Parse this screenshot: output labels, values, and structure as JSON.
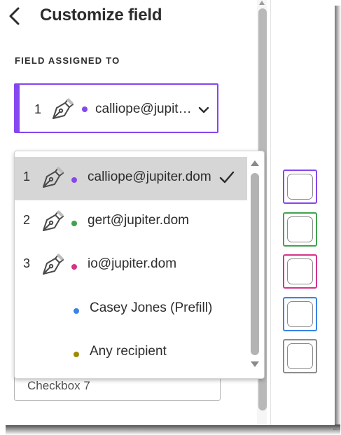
{
  "header": {
    "title": "Customize field"
  },
  "assignment": {
    "section_label": "FIELD ASSIGNED TO",
    "selected": {
      "number": "1",
      "label": "calliope@jupiter.dom",
      "label_truncated": "calliope@jup...",
      "color": "#8547ee"
    }
  },
  "dropdown": {
    "options": [
      {
        "number": "1",
        "label": "calliope@jupiter.dom",
        "color": "#8547ee",
        "signer": true,
        "selected": true
      },
      {
        "number": "2",
        "label": "gert@jupiter.dom",
        "color": "#3fa34d",
        "signer": true,
        "selected": false
      },
      {
        "number": "3",
        "label": "io@jupiter.dom",
        "color": "#d6338a",
        "signer": true,
        "selected": false
      },
      {
        "number": "",
        "label": "Casey Jones (Prefill)",
        "color": "#3a82e6",
        "signer": false,
        "selected": false
      },
      {
        "number": "",
        "label": "Any recipient",
        "color": "#a08a00",
        "signer": false,
        "selected": false
      }
    ]
  },
  "field_name": {
    "value": "Checkbox 7"
  },
  "canvas": {
    "checkboxes": [
      {
        "color": "#8547ee"
      },
      {
        "color": "#3fa34d"
      },
      {
        "color": "#d6338a"
      },
      {
        "color": "#3a82e6"
      },
      {
        "color": "#8c8c8c"
      }
    ]
  }
}
